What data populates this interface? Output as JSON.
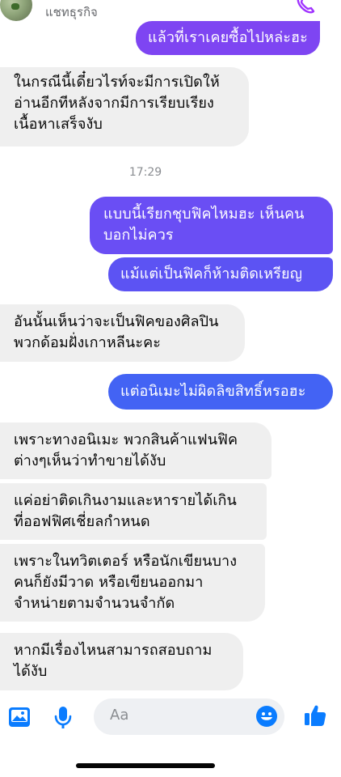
{
  "header": {
    "subtitle": "แชทธุรกิจ",
    "icons": [
      "avatar",
      "phone-icon"
    ]
  },
  "messages": [
    {
      "id": "m1",
      "side": "outgoing",
      "text": "แล้วที่เราเคยซื้อไปหล่ะฮะ"
    },
    {
      "id": "m2",
      "side": "incoming",
      "text": "ในกรณีนี้เดี๋ยวไรท์จะมีการเปิดให้\nอ่านอีกทีหลังจากมีการเรียบเรียง\nเนื้อหาเสร็จงับ"
    },
    {
      "id": "m3",
      "side": "outgoing",
      "text": "แบบนี้เรียกชุบฟิคไหมฮะ เห็นคน\nบอกไม่ควร"
    },
    {
      "id": "m4",
      "side": "outgoing",
      "text": "แม้แต่เป็นฟิคก็ห้ามติดเหรียญ"
    },
    {
      "id": "m5",
      "side": "incoming",
      "text": "อันนั้นเห็นว่าจะเป็นฟิคของศิลปิน\nพวกด้อมฝั่งเกาหลีนะคะ"
    },
    {
      "id": "m6",
      "side": "outgoing",
      "text": "แต่อนิเมะไม่ผิดลิขสิทธิ์หรอฮะ"
    },
    {
      "id": "m7",
      "side": "incoming",
      "text": "เพราะทางอนิเมะ พวกสินค้าแฟนฟิค\nต่างๆเห็นว่าทำขายได้งับ"
    },
    {
      "id": "m8",
      "side": "incoming",
      "text": "แค่อย่าติดเกินงามและหารายได้เกิน\nที่ออฟฟิศเชี่ยลกำหนด"
    },
    {
      "id": "m9",
      "side": "incoming",
      "text": "เพราะในทวิตเตอร์ หรือนักเขียนบาง\nคนก็ยังมีวาด หรือเขียนออกมา\nจำหน่ายตามจำนวนจำกัด"
    },
    {
      "id": "m10",
      "side": "incoming",
      "text": "หากมีเรื่องไหนสามารถสอบถาม\nได้งับ"
    }
  ],
  "timestamp": "17:29",
  "composer": {
    "placeholder": "Aa",
    "icons": [
      "photo-icon",
      "mic-icon",
      "emoji-icon",
      "like-icon"
    ]
  },
  "colors": {
    "accent": "#0a7cff",
    "outgoing_top": "#7e45f2",
    "outgoing_bottom": "#4363f4",
    "incoming_bg": "#efefef"
  }
}
